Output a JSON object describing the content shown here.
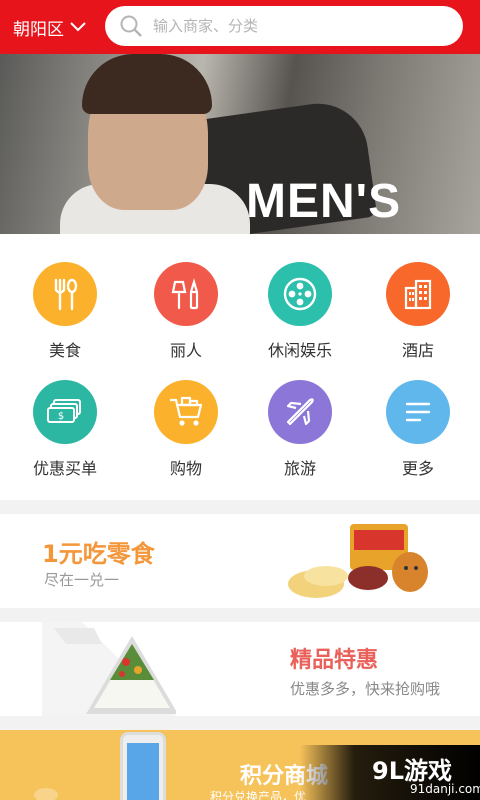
{
  "header": {
    "city": "朝阳区",
    "search_placeholder": "输入商家、分类"
  },
  "banner": {
    "text": "MEN'S"
  },
  "categories": [
    {
      "label": "美食",
      "color": "#fbb12b",
      "icon": "fork-spoon-icon"
    },
    {
      "label": "丽人",
      "color": "#f15a4a",
      "icon": "makeup-brush-icon"
    },
    {
      "label": "休闲娱乐",
      "color": "#2cc0ac",
      "icon": "film-reel-icon"
    },
    {
      "label": "酒店",
      "color": "#f7682a",
      "icon": "building-icon"
    },
    {
      "label": "优惠买单",
      "color": "#2cb7a3",
      "icon": "cash-icon"
    },
    {
      "label": "购物",
      "color": "#fbb12b",
      "icon": "cart-icon"
    },
    {
      "label": "旅游",
      "color": "#8c77d9",
      "icon": "plane-icon"
    },
    {
      "label": "更多",
      "color": "#5fb7ec",
      "icon": "more-lines-icon"
    }
  ],
  "promos": {
    "snack_title": "1元吃零食",
    "snack_sub": "尽在一兑一",
    "deal_title": "精品特惠",
    "deal_sub": "优惠多多，快来抢购哦",
    "points_title": "积分商城",
    "points_sub": "积分兑换产品，优"
  },
  "watermark": {
    "brand": "9L游戏",
    "site": "91danji.com"
  }
}
